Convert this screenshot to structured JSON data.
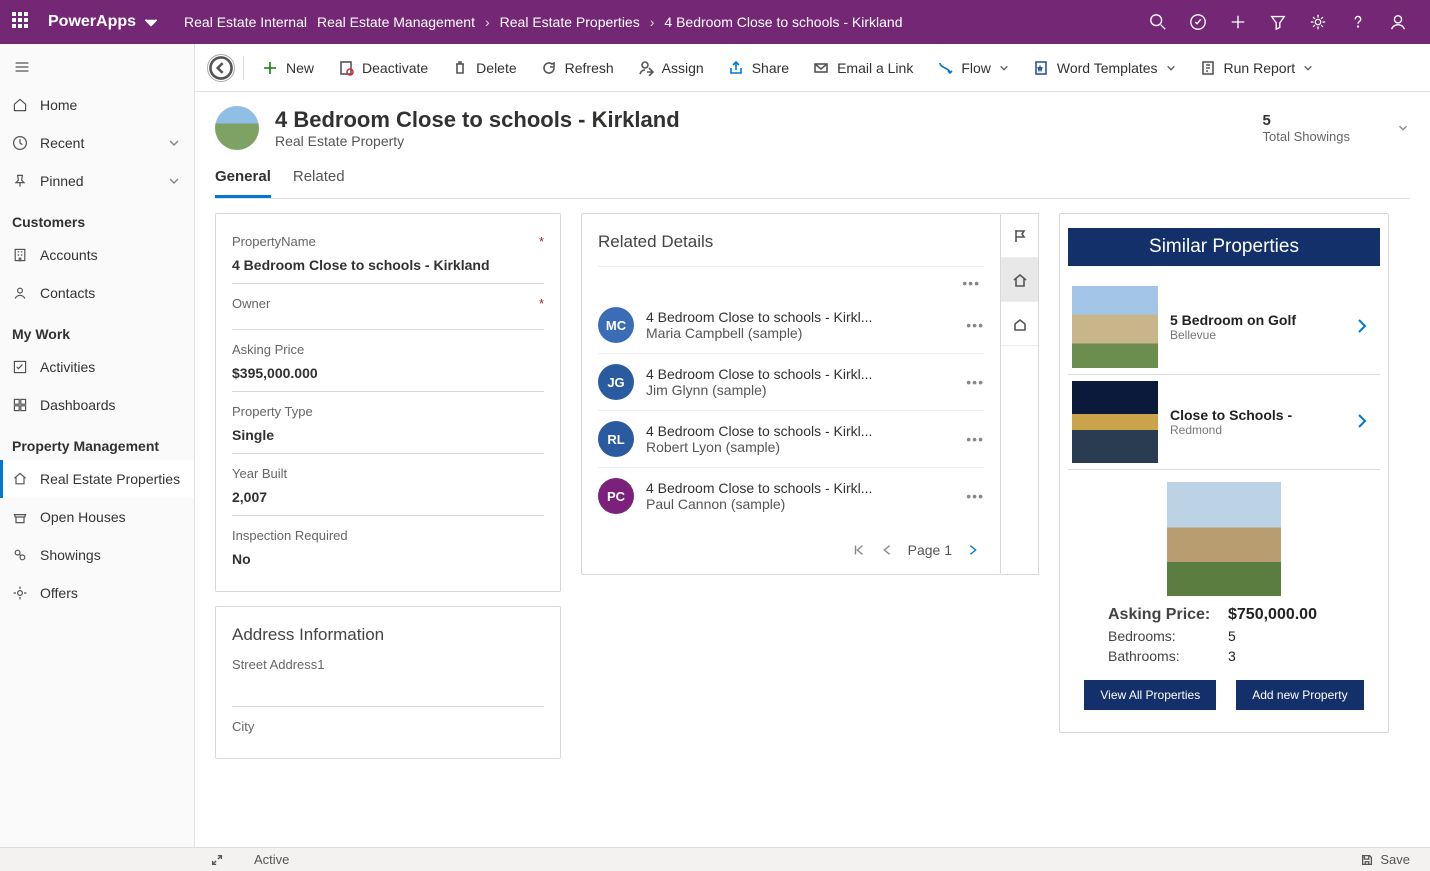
{
  "header": {
    "app_name": "PowerApps",
    "breadcrumb": [
      "Real Estate Internal",
      "Real Estate Management",
      "Real Estate Properties",
      "4 Bedroom Close to schools - Kirkland"
    ]
  },
  "sidebar": {
    "top": [
      {
        "label": "Home",
        "icon": "home"
      },
      {
        "label": "Recent",
        "icon": "clock",
        "chev": true
      },
      {
        "label": "Pinned",
        "icon": "pin",
        "chev": true
      }
    ],
    "sections": [
      {
        "title": "Customers",
        "items": [
          {
            "label": "Accounts",
            "icon": "building"
          },
          {
            "label": "Contacts",
            "icon": "person"
          }
        ]
      },
      {
        "title": "My Work",
        "items": [
          {
            "label": "Activities",
            "icon": "check"
          },
          {
            "label": "Dashboards",
            "icon": "grid"
          }
        ]
      },
      {
        "title": "Property Management",
        "items": [
          {
            "label": "Real Estate Properties",
            "icon": "house",
            "active": true
          },
          {
            "label": "Open Houses",
            "icon": "store"
          },
          {
            "label": "Showings",
            "icon": "eye"
          },
          {
            "label": "Offers",
            "icon": "tag"
          }
        ]
      }
    ]
  },
  "commands": {
    "new": "New",
    "deactivate": "Deactivate",
    "delete": "Delete",
    "refresh": "Refresh",
    "assign": "Assign",
    "share": "Share",
    "email": "Email a Link",
    "flow": "Flow",
    "word": "Word Templates",
    "run": "Run Report"
  },
  "record": {
    "title": "4 Bedroom Close to schools - Kirkland",
    "subtitle": "Real Estate Property",
    "kpi_value": "5",
    "kpi_label": "Total Showings"
  },
  "tabs": [
    "General",
    "Related"
  ],
  "form": {
    "fields": [
      {
        "label": "PropertyName",
        "value": "4 Bedroom Close to schools - Kirkland",
        "required": true
      },
      {
        "label": "Owner",
        "value": "",
        "required": true
      },
      {
        "label": "Asking Price",
        "value": "$395,000.000"
      },
      {
        "label": "Property Type",
        "value": "Single"
      },
      {
        "label": "Year Built",
        "value": "2,007"
      },
      {
        "label": "Inspection Required",
        "value": "No"
      }
    ],
    "address_title": "Address Information",
    "address_fields": [
      {
        "label": "Street Address1",
        "value": ""
      },
      {
        "label": "City",
        "value": ""
      }
    ]
  },
  "related": {
    "title": "Related Details",
    "items": [
      {
        "initials": "MC",
        "color": "#3a6db5",
        "title": "4 Bedroom Close to schools - Kirkl...",
        "sub": "Maria Campbell (sample)"
      },
      {
        "initials": "JG",
        "color": "#2a5aa0",
        "title": "4 Bedroom Close to schools - Kirkl...",
        "sub": "Jim Glynn (sample)"
      },
      {
        "initials": "RL",
        "color": "#2a5aa0",
        "title": "4 Bedroom Close to schools - Kirkl...",
        "sub": "Robert Lyon (sample)"
      },
      {
        "initials": "PC",
        "color": "#7b217b",
        "title": "4 Bedroom Close to schools - Kirkl...",
        "sub": "Paul Cannon (sample)"
      }
    ],
    "page": "Page 1"
  },
  "similar": {
    "title": "Similar Properties",
    "items": [
      {
        "name": "5 Bedroom on Golf",
        "loc": "Bellevue"
      },
      {
        "name": "Close to Schools -",
        "loc": "Redmond"
      }
    ],
    "feature": {
      "asking_label": "Asking Price:",
      "asking_value": "$750,000.00",
      "bedrooms_label": "Bedrooms:",
      "bedrooms_value": "5",
      "bathrooms_label": "Bathrooms:",
      "bathrooms_value": "3"
    },
    "btn_view": "View All Properties",
    "btn_add": "Add new Property"
  },
  "status": {
    "state": "Active",
    "save": "Save"
  }
}
